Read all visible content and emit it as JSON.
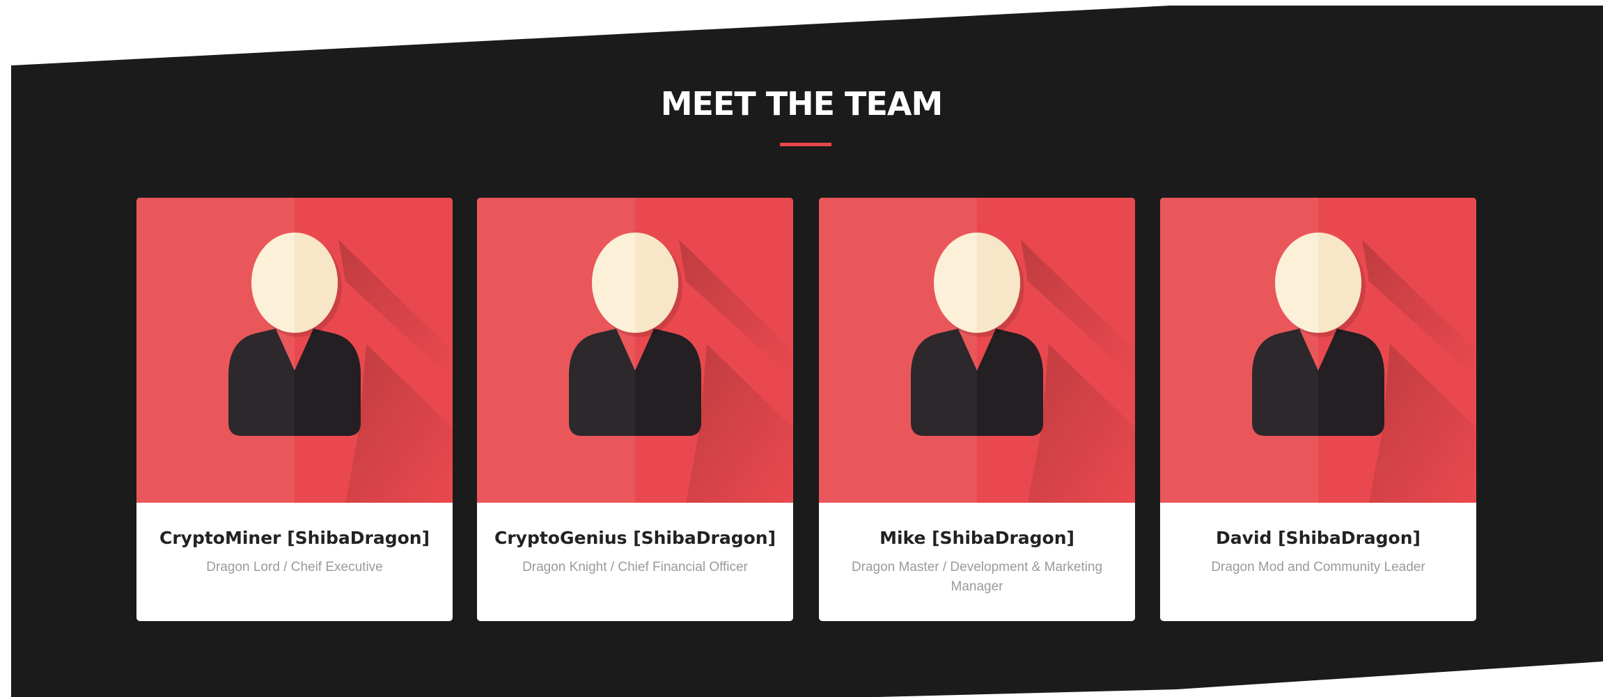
{
  "section": {
    "title": "MEET THE TEAM"
  },
  "colors": {
    "dark_background": "#1b1b1b",
    "accent_red": "#e8474c",
    "card_red_light": "#ea575b",
    "card_red_dark": "#e9494e",
    "face": "#fdf0d8",
    "suit": "#2c282b"
  },
  "team": [
    {
      "name": "CryptoMiner [ShibaDragon]",
      "role": "Dragon Lord / Cheif Executive",
      "icon": "person-avatar-icon"
    },
    {
      "name": "CryptoGenius [ShibaDragon]",
      "role": "Dragon Knight / Chief Financial Officer",
      "icon": "person-avatar-icon"
    },
    {
      "name": "Mike [ShibaDragon]",
      "role": "Dragon Master / Development & Marketing Manager",
      "icon": "person-avatar-icon"
    },
    {
      "name": "David [ShibaDragon]",
      "role": "Dragon Mod and Community Leader",
      "icon": "person-avatar-icon"
    }
  ]
}
